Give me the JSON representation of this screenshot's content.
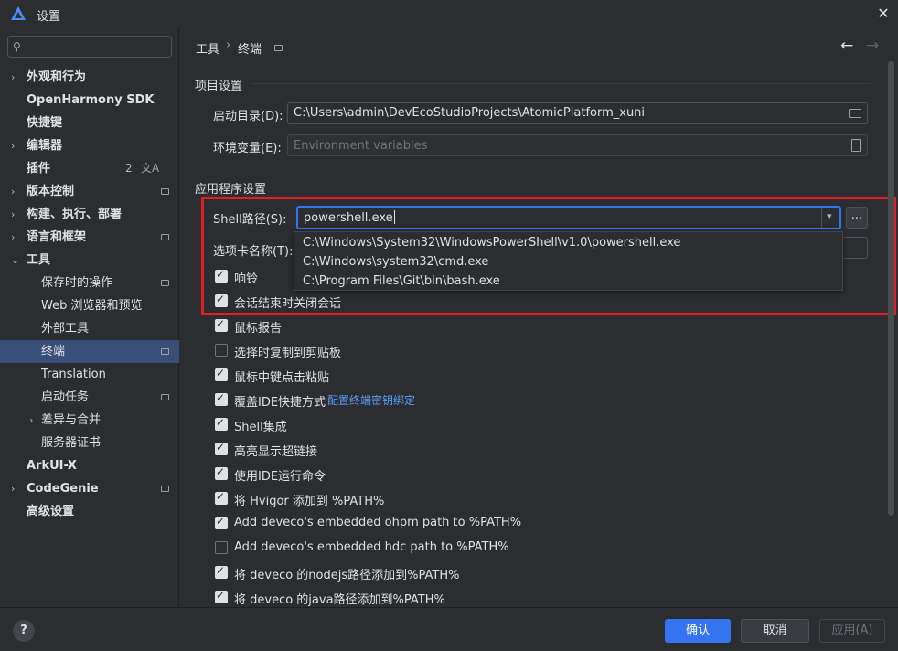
{
  "window": {
    "title": "设置",
    "close_glyph": "✕"
  },
  "search": {
    "placeholder": "",
    "icon": "search-icon"
  },
  "sidebar": {
    "items": [
      {
        "label": "外观和行为",
        "expandable": true,
        "bold": true
      },
      {
        "label": "OpenHarmony SDK",
        "expandable": false,
        "bold": true
      },
      {
        "label": "快捷键",
        "expandable": false,
        "bold": true
      },
      {
        "label": "编辑器",
        "expandable": true,
        "bold": true
      },
      {
        "label": "插件",
        "expandable": false,
        "bold": true,
        "badge": "2",
        "icon": "translate-icon"
      },
      {
        "label": "版本控制",
        "expandable": true,
        "bold": true,
        "icon": "page-icon"
      },
      {
        "label": "构建、执行、部署",
        "expandable": true,
        "bold": true
      },
      {
        "label": "语言和框架",
        "expandable": true,
        "bold": true,
        "icon": "page-icon"
      },
      {
        "label": "工具",
        "expandable": true,
        "expanded": true,
        "bold": true
      },
      {
        "label": "保存时的操作",
        "indent": 1,
        "icon": "page-icon"
      },
      {
        "label": "Web 浏览器和预览",
        "indent": 1
      },
      {
        "label": "外部工具",
        "indent": 1
      },
      {
        "label": "终端",
        "indent": 1,
        "selected": true,
        "icon": "page-icon"
      },
      {
        "label": "Translation",
        "indent": 1
      },
      {
        "label": "启动任务",
        "indent": 1,
        "icon": "page-icon"
      },
      {
        "label": "差异与合并",
        "indent": 1,
        "expandable": true
      },
      {
        "label": "服务器证书",
        "indent": 1
      },
      {
        "label": "ArkUI-X",
        "bold": true
      },
      {
        "label": "CodeGenie",
        "expandable": true,
        "bold": true,
        "icon": "page-icon"
      },
      {
        "label": "高级设置",
        "bold": true
      }
    ],
    "arrow_glyph": "›",
    "expanded_arrow_glyph": "⌄",
    "translate_glyph": "文A"
  },
  "breadcrumb": {
    "parent": "工具",
    "separator": "›",
    "current": "终端",
    "back_glyph": "←",
    "forward_glyph": "→"
  },
  "project_settings": {
    "title": "项目设置",
    "start_dir_label": "启动目录(D):",
    "start_dir_value": "C:\\Users\\admin\\DevEcoStudioProjects\\AtomicPlatform_xuni",
    "env_label": "环境变量(E):",
    "env_placeholder": "Environment variables"
  },
  "app_settings": {
    "title": "应用程序设置",
    "shell_label": "Shell路径(S):",
    "shell_value": "powershell.exe",
    "browse_label": "...",
    "dropdown_arrow": "▾",
    "tab_name_label": "选项卡名称(T):",
    "shell_options": [
      "C:\\Windows\\System32\\WindowsPowerShell\\v1.0\\powershell.exe",
      "C:\\Windows\\system32\\cmd.exe",
      "C:\\Program Files\\Git\\bin\\bash.exe"
    ]
  },
  "options": [
    {
      "label": "响铃",
      "checked": true
    },
    {
      "label": "会话结束时关闭会话",
      "checked": true
    },
    {
      "label": "鼠标报告",
      "checked": true
    },
    {
      "label": "选择时复制到剪贴板",
      "checked": false
    },
    {
      "label": "鼠标中键点击粘贴",
      "checked": true
    },
    {
      "label": "覆盖IDE快捷方式",
      "checked": true,
      "link": "配置终端密钥绑定"
    },
    {
      "label": "Shell集成",
      "checked": true
    },
    {
      "label": "高亮显示超链接",
      "checked": true
    },
    {
      "label": "使用IDE运行命令",
      "checked": true
    },
    {
      "label": "将 Hvigor 添加到 %PATH%",
      "checked": true
    },
    {
      "label": "Add deveco's embedded ohpm path to %PATH%",
      "checked": true
    },
    {
      "label": "Add deveco's embedded hdc path to %PATH%",
      "checked": false
    },
    {
      "label": "将 deveco 的nodejs路径添加到%PATH%",
      "checked": true
    },
    {
      "label": "将 deveco 的java路径添加到%PATH%",
      "checked": true
    }
  ],
  "footer": {
    "help": "?",
    "ok": "确认",
    "cancel": "取消",
    "apply": "应用(A)"
  },
  "colors": {
    "accent": "#3574f0",
    "highlight_box": "#e01e25",
    "selected_item": "#3a4e7a",
    "link": "#589df6"
  }
}
